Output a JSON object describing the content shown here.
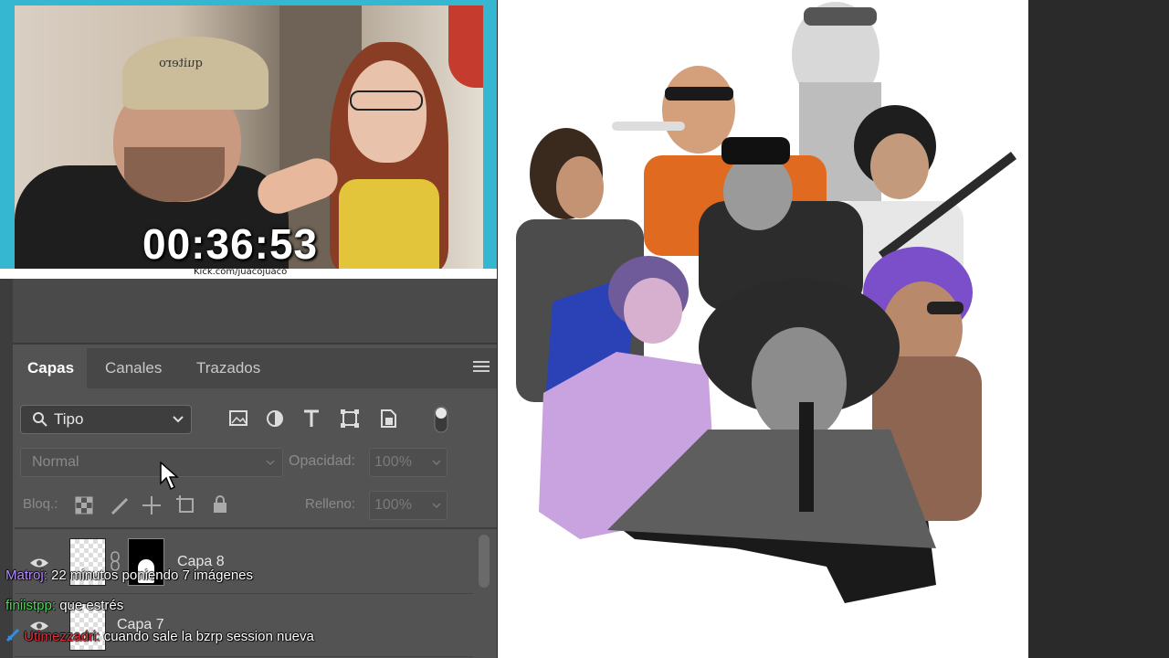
{
  "stream": {
    "timer": "00:36:53",
    "kick_url": "Kick.com/juacojuaco",
    "cap_text": "quitero"
  },
  "photoshop": {
    "tabs": [
      {
        "label": "Capas",
        "active": true
      },
      {
        "label": "Canales",
        "active": false
      },
      {
        "label": "Trazados",
        "active": false
      }
    ],
    "filter": {
      "label": "Tipo"
    },
    "blend_mode": "Normal",
    "opacity": {
      "label": "Opacidad:",
      "value": "100%"
    },
    "lock": {
      "label": "Bloq.:"
    },
    "fill": {
      "label": "Relleno:",
      "value": "100%"
    },
    "layers": [
      {
        "name": "Capa 8",
        "visible": true
      },
      {
        "name": "Capa 7",
        "visible": true
      }
    ]
  },
  "chat": [
    {
      "user": "Matroj:",
      "message": "22 minutos poniendo 7 imágenes",
      "color": "#b48cff"
    },
    {
      "user": "finiistpp:",
      "message": "que estrés",
      "color": "#4cdb5a"
    },
    {
      "user": "Utimezzadri:",
      "message": "cuando sale la bzrp session nueva",
      "color": "#e0323c",
      "badge": true
    }
  ],
  "colors": {
    "stream_border": "#35b6d1",
    "ps_panel": "#535353",
    "canvas": "#ffffff"
  }
}
